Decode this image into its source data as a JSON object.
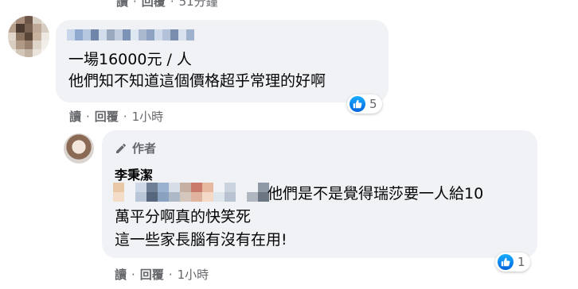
{
  "top_actions": {
    "read": "讀",
    "reply": "回覆",
    "time": "51分鐘"
  },
  "comment1": {
    "lines": [
      "一場16000元 / 人",
      "他們知不知道這個價格超乎常理的好啊"
    ],
    "reaction_count": "5",
    "actions": {
      "read": "讀",
      "reply": "回覆",
      "time": "1小時"
    }
  },
  "reply1": {
    "author_tag": "作者",
    "author_name": "李秉潔",
    "line1_text": "他們是不是覺得瑞莎要一人給10",
    "line2": "萬平分啊真的快笑死",
    "line3": "這一些家長腦有沒有在用!",
    "reaction_count": "1",
    "actions": {
      "read": "讀",
      "reply": "回覆",
      "time": "1小時"
    }
  },
  "colors": {
    "bubble": "#f0f2f5",
    "meta": "#65676b",
    "like": "#1877f2"
  },
  "icons": [
    "like-icon",
    "pencil-icon"
  ]
}
